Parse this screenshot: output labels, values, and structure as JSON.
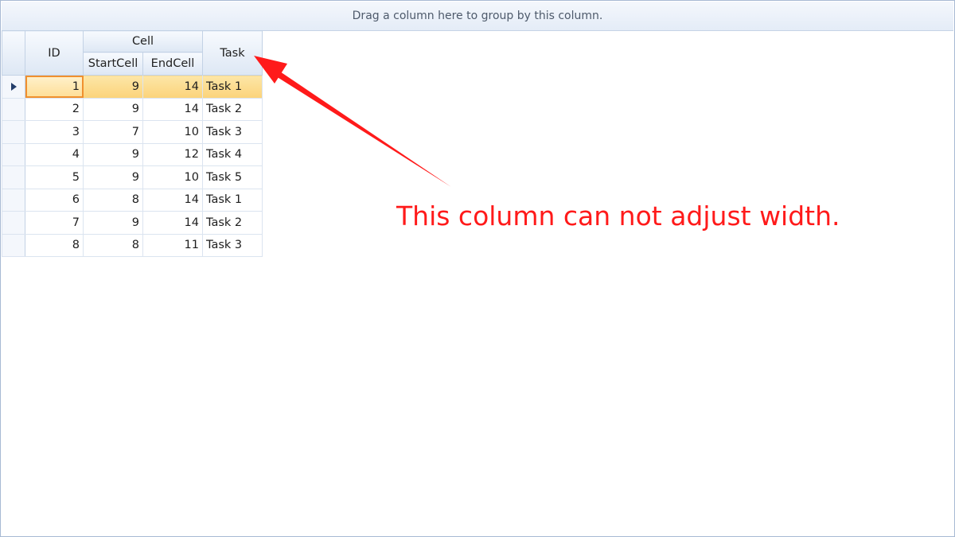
{
  "group_panel": {
    "text": "Drag a column here to group by this column."
  },
  "grid": {
    "headers": {
      "id": "ID",
      "cell_band": "Cell",
      "start_cell": "StartCell",
      "end_cell": "EndCell",
      "task": "Task"
    },
    "selected_row": 0,
    "rows": [
      {
        "id": "1",
        "start": "9",
        "end": "14",
        "task": "Task 1"
      },
      {
        "id": "2",
        "start": "9",
        "end": "14",
        "task": "Task 2"
      },
      {
        "id": "3",
        "start": "7",
        "end": "10",
        "task": "Task 3"
      },
      {
        "id": "4",
        "start": "9",
        "end": "12",
        "task": "Task 4"
      },
      {
        "id": "5",
        "start": "9",
        "end": "10",
        "task": "Task 5"
      },
      {
        "id": "6",
        "start": "8",
        "end": "14",
        "task": "Task 1"
      },
      {
        "id": "7",
        "start": "9",
        "end": "14",
        "task": "Task 2"
      },
      {
        "id": "8",
        "start": "8",
        "end": "11",
        "task": "Task 3"
      }
    ]
  },
  "annotation": {
    "text": "This column can not adjust width.",
    "color": "#ff1a1a"
  },
  "colors": {
    "selected_row": "#fbd37a",
    "focus_border": "#f0902e",
    "header": "#dde7f4"
  }
}
